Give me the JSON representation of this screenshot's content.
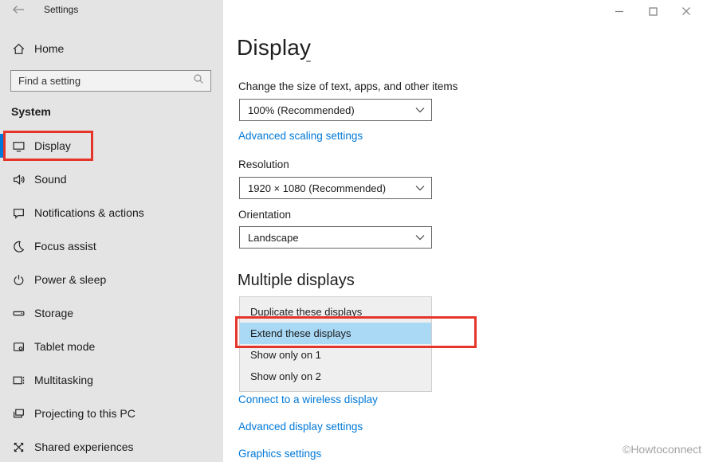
{
  "window": {
    "title": "Settings"
  },
  "colors": {
    "accent": "#0078d7",
    "highlight": "#a9d9f5",
    "annotation": "#e5352b"
  },
  "sidebar": {
    "home_label": "Home",
    "search_placeholder": "Find a setting",
    "section_title": "System",
    "items": [
      {
        "label": "Display",
        "icon": "display-icon",
        "selected": true
      },
      {
        "label": "Sound",
        "icon": "sound-icon",
        "selected": false
      },
      {
        "label": "Notifications & actions",
        "icon": "notifications-icon",
        "selected": false
      },
      {
        "label": "Focus assist",
        "icon": "focus-assist-icon",
        "selected": false
      },
      {
        "label": "Power & sleep",
        "icon": "power-icon",
        "selected": false
      },
      {
        "label": "Storage",
        "icon": "storage-icon",
        "selected": false
      },
      {
        "label": "Tablet mode",
        "icon": "tablet-mode-icon",
        "selected": false
      },
      {
        "label": "Multitasking",
        "icon": "multitasking-icon",
        "selected": false
      },
      {
        "label": "Projecting to this PC",
        "icon": "projecting-icon",
        "selected": false
      },
      {
        "label": "Shared experiences",
        "icon": "shared-experiences-icon",
        "selected": false
      }
    ]
  },
  "main": {
    "title": "Display",
    "scale": {
      "label": "Change the size of text, apps, and other items",
      "value": "100% (Recommended)"
    },
    "advanced_scaling_link": "Advanced scaling settings",
    "resolution": {
      "label": "Resolution",
      "value": "1920 × 1080 (Recommended)"
    },
    "orientation": {
      "label": "Orientation",
      "value": "Landscape"
    },
    "multiple_displays": {
      "title": "Multiple displays",
      "options": [
        "Duplicate these displays",
        "Extend these displays",
        "Show only on 1",
        "Show only on 2"
      ],
      "selected": "Extend these displays"
    },
    "links": [
      "Connect to a wireless display",
      "Advanced display settings",
      "Graphics settings"
    ]
  },
  "watermark": "©Howtoconnect"
}
